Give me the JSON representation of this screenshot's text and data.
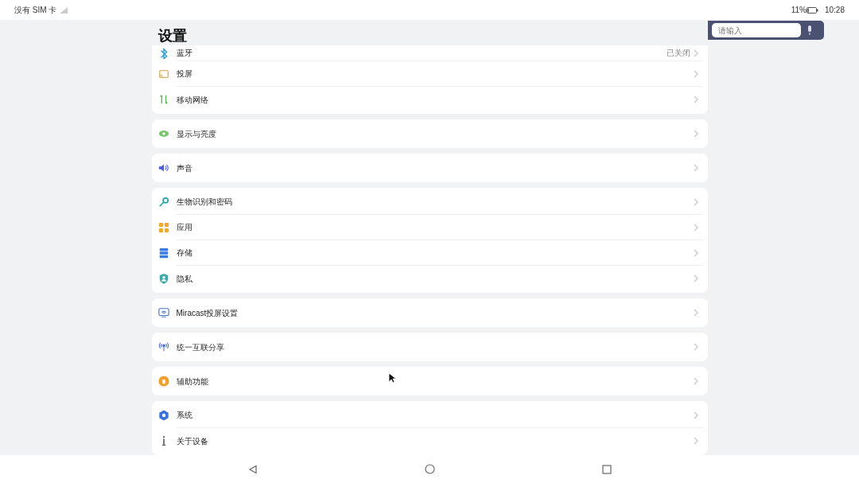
{
  "status_bar": {
    "carrier": "没有 SIM 卡",
    "battery": "11%",
    "time": "10:28"
  },
  "title": "设置",
  "search": {
    "placeholder": "请输入"
  },
  "groups": [
    {
      "items": [
        {
          "label": "蓝牙",
          "value": "已关闭"
        },
        {
          "label": "投屏"
        },
        {
          "label": "移动网络"
        }
      ]
    },
    {
      "items": [
        {
          "label": "显示与亮度"
        }
      ]
    },
    {
      "items": [
        {
          "label": "声音"
        }
      ]
    },
    {
      "items": [
        {
          "label": "生物识别和密码"
        },
        {
          "label": "应用"
        },
        {
          "label": "存储"
        },
        {
          "label": "隐私"
        }
      ]
    },
    {
      "items": [
        {
          "label": "Miracast投屏设置"
        }
      ]
    },
    {
      "items": [
        {
          "label": "统一互联分享"
        }
      ]
    },
    {
      "items": [
        {
          "label": "辅助功能"
        }
      ]
    },
    {
      "items": [
        {
          "label": "系统"
        },
        {
          "label": "关于设备"
        }
      ]
    }
  ]
}
